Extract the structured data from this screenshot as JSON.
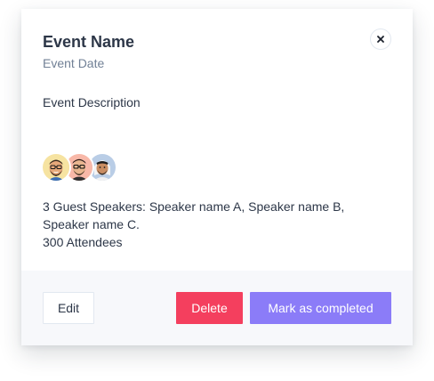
{
  "event": {
    "name": "Event Name",
    "date": "Event Date",
    "description": "Event Description",
    "speakers_text": "3 Guest Speakers: Speaker name A, Speaker name B, Speaker name C.",
    "attendees_text": "300 Attendees"
  },
  "speakers": [
    {
      "avatar_icon": "speaker-a-avatar",
      "bg_color": "#f6e3a1"
    },
    {
      "avatar_icon": "speaker-b-avatar",
      "bg_color": "#f8b8a8"
    },
    {
      "avatar_icon": "speaker-c-avatar",
      "bg_color": "#b9cde6"
    }
  ],
  "actions": {
    "close_icon": "close-icon",
    "edit_label": "Edit",
    "delete_label": "Delete",
    "complete_label": "Mark as completed"
  },
  "colors": {
    "title": "#2d3748",
    "muted": "#718096",
    "danger": "#f43f5e",
    "primary": "#8b7cf8",
    "footer_bg": "#f7f8fb"
  }
}
